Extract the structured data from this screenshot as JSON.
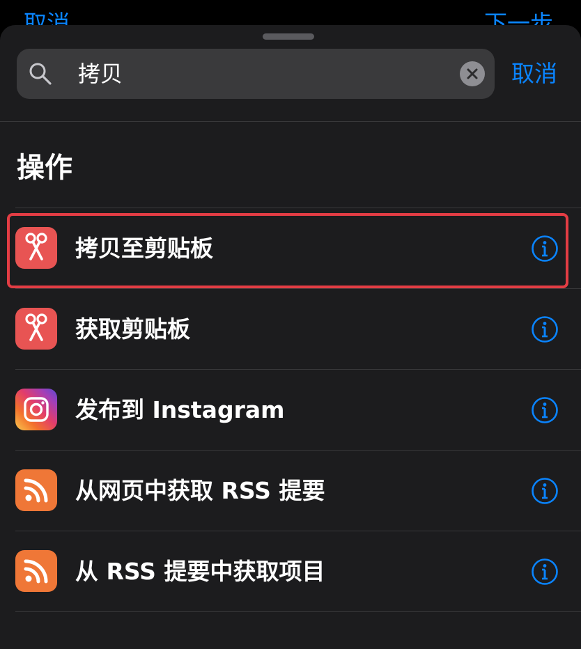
{
  "background_nav": {
    "left_label": "取消",
    "right_label": "下一步"
  },
  "search": {
    "query": "拷贝",
    "cancel_label": "取消"
  },
  "section": {
    "title": "操作"
  },
  "actions": [
    {
      "label": "拷贝至剪贴板",
      "icon": "scissors-icon",
      "color": "#e85453",
      "selected": true
    },
    {
      "label": "获取剪贴板",
      "icon": "scissors-icon",
      "color": "#e85453"
    },
    {
      "label": "发布到 Instagram",
      "icon": "instagram-icon",
      "color": "gradient"
    },
    {
      "label": "从网页中获取 RSS 提要",
      "icon": "rss-icon",
      "color": "#ef7737"
    },
    {
      "label": "从 RSS 提要中获取项目",
      "icon": "rss-icon",
      "color": "#ef7737"
    }
  ],
  "colors": {
    "accent": "#0a84ff",
    "highlight_border": "#e33d44"
  }
}
